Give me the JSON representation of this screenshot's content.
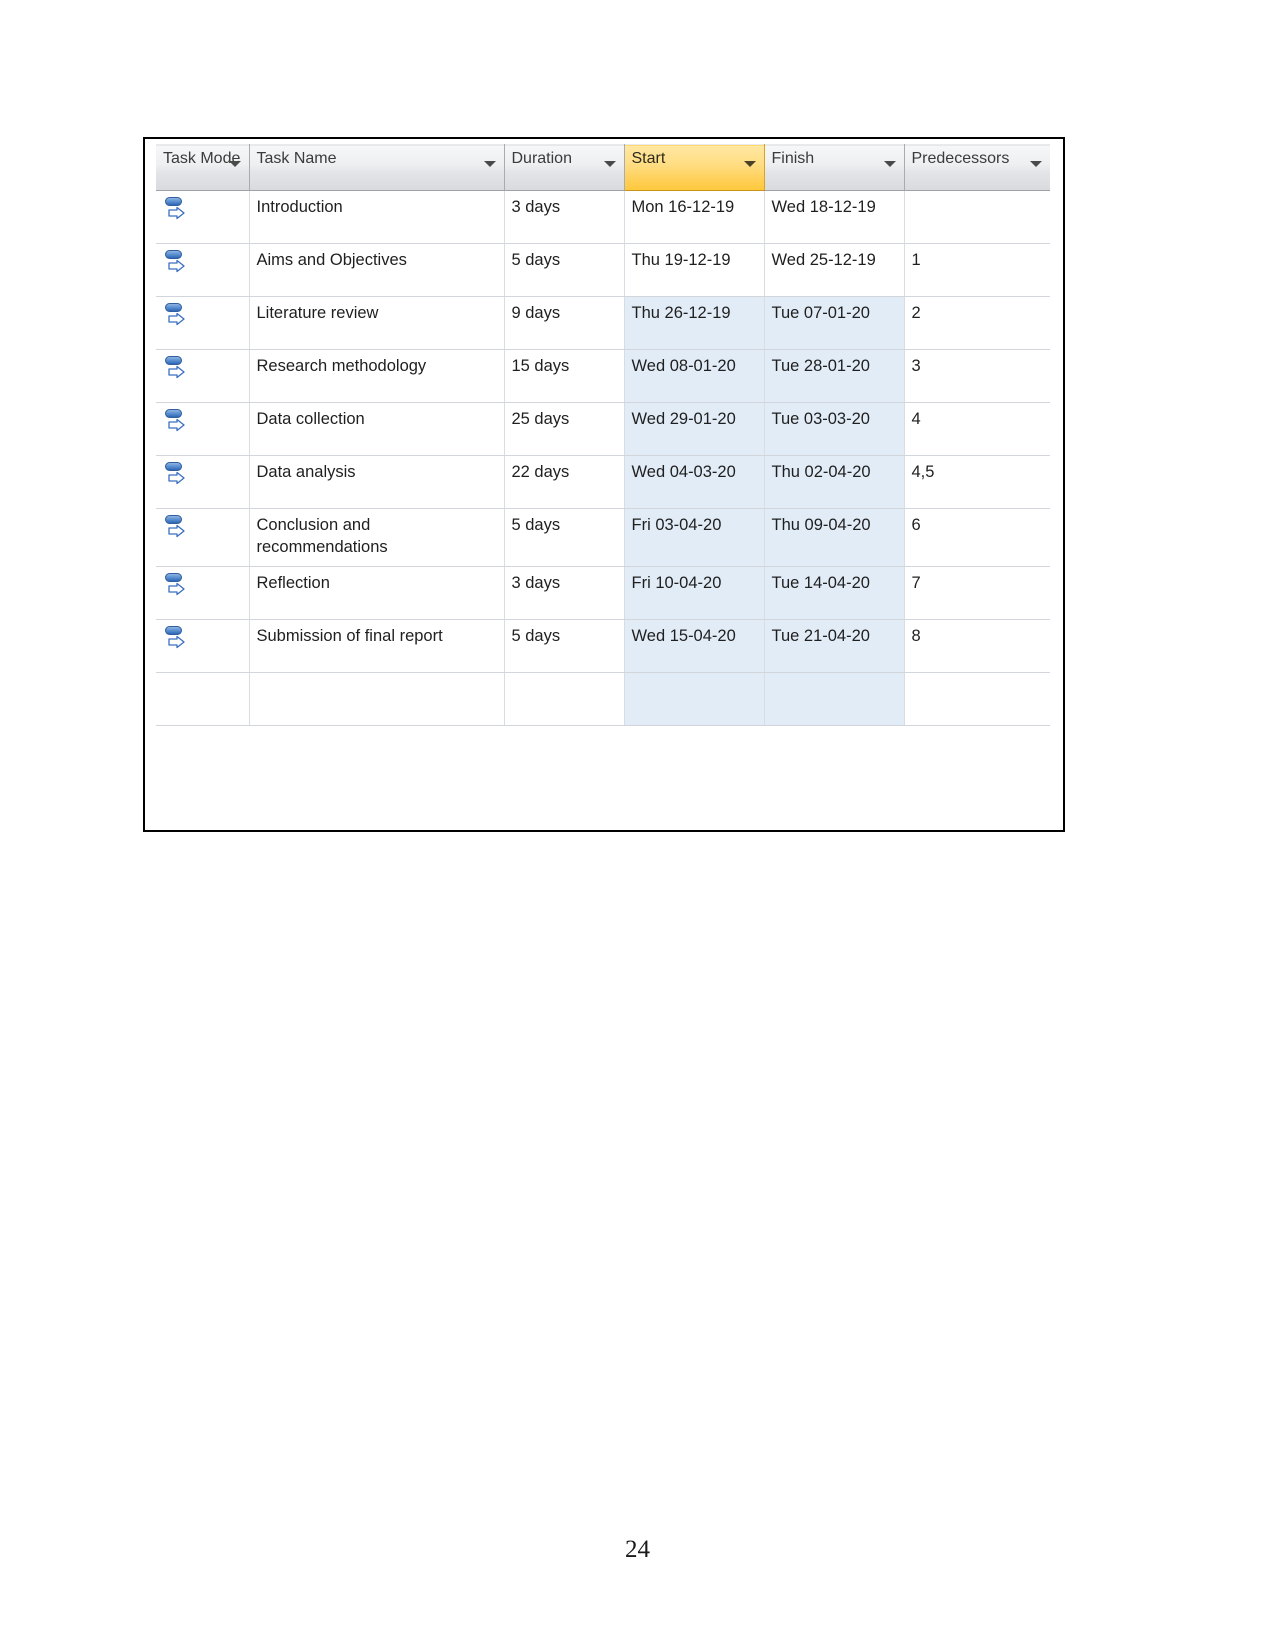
{
  "document": {
    "page_number": "24"
  },
  "gantt_table": {
    "columns": [
      {
        "key": "task_mode",
        "label": "Task Mode",
        "has_filter_caret": true,
        "selected": false
      },
      {
        "key": "task_name",
        "label": "Task Name",
        "has_filter_caret": true,
        "selected": false
      },
      {
        "key": "duration",
        "label": "Duration",
        "has_filter_caret": true,
        "selected": false
      },
      {
        "key": "start",
        "label": "Start",
        "has_filter_caret": true,
        "selected": true
      },
      {
        "key": "finish",
        "label": "Finish",
        "has_filter_caret": true,
        "selected": false
      },
      {
        "key": "predecessors",
        "label": "Predecessors",
        "has_filter_caret": true,
        "selected": false
      }
    ],
    "selected_column": "Start",
    "task_mode_icon": "auto-scheduled-icon",
    "rows": [
      {
        "id": 1,
        "task_mode": "auto-scheduled-icon",
        "task_name": "Introduction",
        "duration": "3 days",
        "start": "Mon 16-12-19",
        "finish": "Wed 18-12-19",
        "predecessors": "",
        "tinted": false
      },
      {
        "id": 2,
        "task_mode": "auto-scheduled-icon",
        "task_name": "Aims and Objectives",
        "duration": "5 days",
        "start": "Thu 19-12-19",
        "finish": "Wed 25-12-19",
        "predecessors": "1",
        "tinted": false
      },
      {
        "id": 3,
        "task_mode": "auto-scheduled-icon",
        "task_name": "Literature review",
        "duration": "9 days",
        "start": "Thu 26-12-19",
        "finish": "Tue 07-01-20",
        "predecessors": "2",
        "tinted": true
      },
      {
        "id": 4,
        "task_mode": "auto-scheduled-icon",
        "task_name": "Research methodology",
        "duration": "15 days",
        "start": "Wed 08-01-20",
        "finish": "Tue 28-01-20",
        "predecessors": "3",
        "tinted": true
      },
      {
        "id": 5,
        "task_mode": "auto-scheduled-icon",
        "task_name": "Data collection",
        "duration": "25 days",
        "start": "Wed 29-01-20",
        "finish": "Tue 03-03-20",
        "predecessors": "4",
        "tinted": true
      },
      {
        "id": 6,
        "task_mode": "auto-scheduled-icon",
        "task_name": "Data analysis",
        "duration": "22 days",
        "start": "Wed 04-03-20",
        "finish": "Thu 02-04-20",
        "predecessors": "4,5",
        "tinted": true
      },
      {
        "id": 7,
        "task_mode": "auto-scheduled-icon",
        "task_name": "Conclusion and recommendations",
        "duration": "5 days",
        "start": "Fri 03-04-20",
        "finish": "Thu 09-04-20",
        "predecessors": "6",
        "tinted": true
      },
      {
        "id": 8,
        "task_mode": "auto-scheduled-icon",
        "task_name": "Reflection",
        "duration": "3 days",
        "start": "Fri 10-04-20",
        "finish": "Tue 14-04-20",
        "predecessors": "7",
        "tinted": true
      },
      {
        "id": 9,
        "task_mode": "auto-scheduled-icon",
        "task_name": "Submission of final report",
        "duration": "5 days",
        "start": "Wed 15-04-20",
        "finish": "Tue 21-04-20",
        "predecessors": "8",
        "tinted": true
      }
    ]
  },
  "colors": {
    "selected_header_gold": "#ffd15f",
    "tinted_cell_blue": "#e2ecf7",
    "header_gray": "#e2e4e7",
    "grid_line": "#d2d6dc",
    "task_mode_icon_blue": "#2e66b5",
    "frame_border": "#000000"
  }
}
